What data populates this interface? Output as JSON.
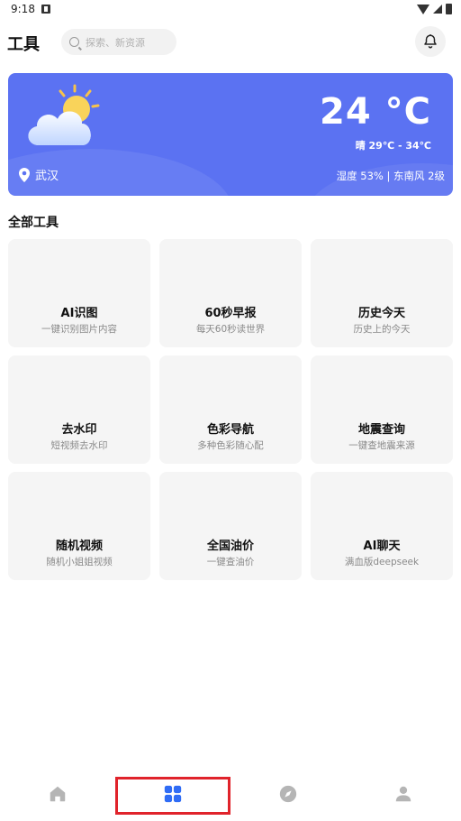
{
  "status_bar": {
    "time": "9:18"
  },
  "header": {
    "title": "工具",
    "search_placeholder": "探索、新资源"
  },
  "weather": {
    "temperature": "24 °C",
    "condition_range": "晴 29℃ - 34℃",
    "city": "武汉",
    "details": "湿度 53% | 东南风 2级"
  },
  "section": {
    "title": "全部工具"
  },
  "tools": [
    {
      "name": "AI识图",
      "desc": "一键识别图片内容"
    },
    {
      "name": "60秒早报",
      "desc": "每天60秒读世界"
    },
    {
      "name": "历史今天",
      "desc": "历史上的今天"
    },
    {
      "name": "去水印",
      "desc": "短视频去水印"
    },
    {
      "name": "色彩导航",
      "desc": "多种色彩随心配"
    },
    {
      "name": "地震查询",
      "desc": "一键查地震来源"
    },
    {
      "name": "随机视频",
      "desc": "随机小姐姐视频"
    },
    {
      "name": "全国油价",
      "desc": "一键查油价"
    },
    {
      "name": "AI聊天",
      "desc": "满血版deepseek"
    }
  ],
  "nav": {
    "items": [
      "home-icon",
      "grid-icon",
      "compass-icon",
      "user-icon"
    ],
    "active_color": "#2f6cf5",
    "inactive_color": "#b5b5b5"
  },
  "colors": {
    "weather_card": "#5b72f2",
    "highlight": "#e0232b"
  }
}
